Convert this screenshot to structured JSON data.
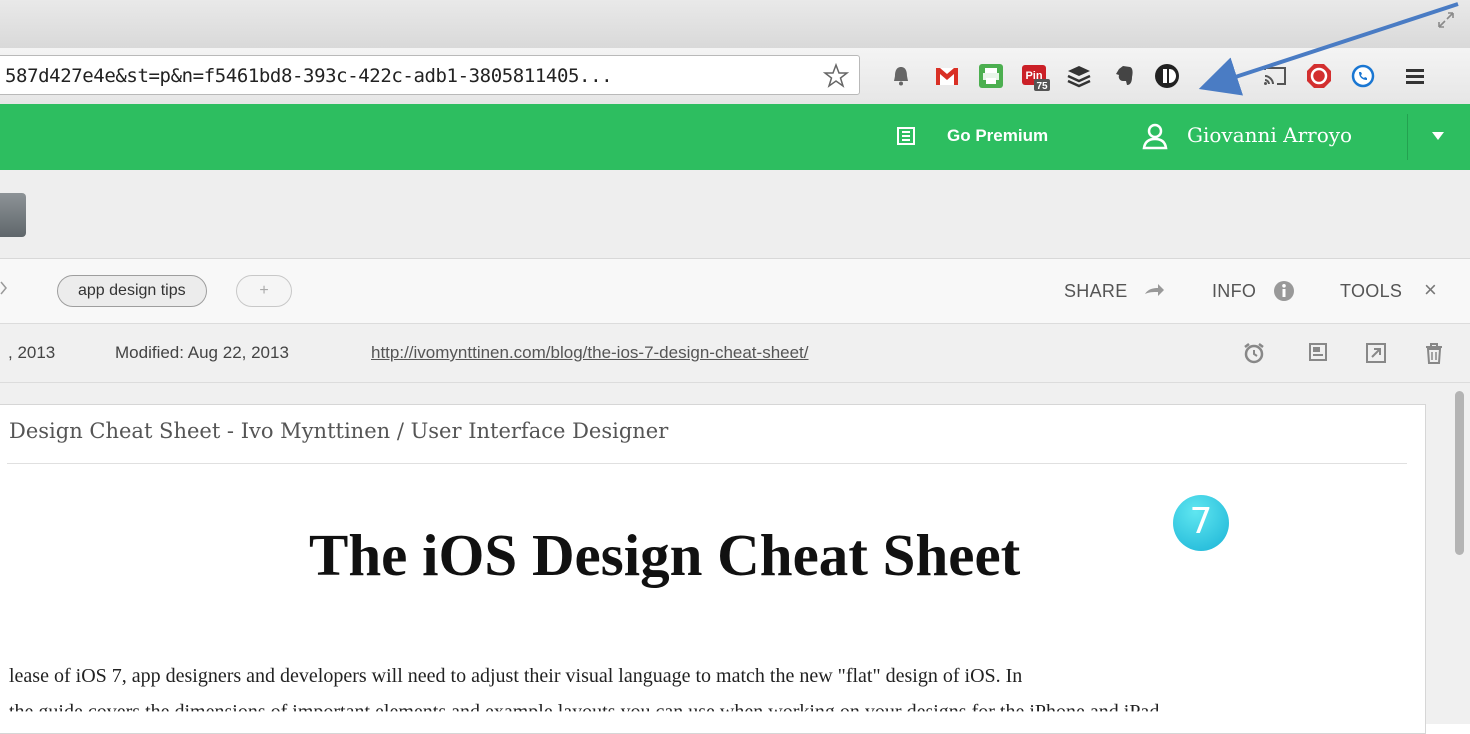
{
  "browser": {
    "url": "587d427e4e&st=p&n=f5461bd8-393c-422c-adb1-3805811405...",
    "extensions": [
      {
        "name": "notifications-bell",
        "icon": "bell-icon"
      },
      {
        "name": "gmail",
        "icon": "gmail-icon"
      },
      {
        "name": "print-friendly",
        "icon": "printer-icon"
      },
      {
        "name": "pinterest",
        "icon": "pinterest-icon",
        "label": "Pin",
        "badge": "75"
      },
      {
        "name": "buffer",
        "icon": "layers-icon"
      },
      {
        "name": "evernote",
        "icon": "elephant-icon"
      },
      {
        "name": "instapaper",
        "icon": "instapaper-icon"
      },
      {
        "name": "cast",
        "icon": "cast-icon"
      },
      {
        "name": "stop",
        "icon": "stop-hand-icon"
      },
      {
        "name": "phone",
        "icon": "phone-icon"
      },
      {
        "name": "menu",
        "icon": "hamburger-menu-icon"
      }
    ]
  },
  "header": {
    "premium_label": "Go Premium",
    "user_name": "Giovanni Arroyo",
    "brand_color": "#2dbe60"
  },
  "note": {
    "tag": "app design tips",
    "add_tag": "+",
    "share_label": "SHARE",
    "info_label": "INFO",
    "tools_label": "TOOLS",
    "close": "×",
    "created": ", 2013",
    "modified": "Modified: Aug 22, 2013",
    "source_url": "http://ivomynttinen.com/blog/the-ios-7-design-cheat-sheet/",
    "title": "Design Cheat Sheet - Ivo Mynttinen / User Interface Designer",
    "headline": "The iOS Design Cheat Sheet",
    "badge": "7",
    "paragraph_1": "lease of iOS 7, app designers and developers will need to adjust their visual language to match the new \"flat\" design of iOS. In",
    "paragraph_2": "the guide covers the dimensions of important elements and example layouts you can use when working on your designs for the iPhone and iPad"
  }
}
